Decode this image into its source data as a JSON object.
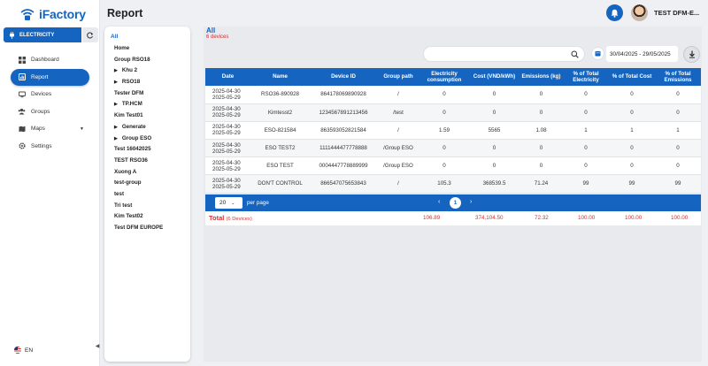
{
  "app": {
    "logo_text": "iFactory"
  },
  "sidebar": {
    "module_label": "ELECTRICITY",
    "items": [
      {
        "label": "Dashboard",
        "icon": "dashboard-icon"
      },
      {
        "label": "Report",
        "icon": "report-icon",
        "active": true
      },
      {
        "label": "Devices",
        "icon": "devices-icon"
      },
      {
        "label": "Groups",
        "icon": "groups-icon"
      },
      {
        "label": "Maps",
        "icon": "maps-icon"
      },
      {
        "label": "Settings",
        "icon": "settings-icon"
      }
    ],
    "language": "EN"
  },
  "header": {
    "title": "Report",
    "user_name": "TEST DFM-E..."
  },
  "tree": {
    "all_label": "All",
    "nodes": [
      {
        "label": "Home",
        "expandable": false
      },
      {
        "label": "Group RSO18",
        "expandable": false
      },
      {
        "label": "Khu 2",
        "expandable": true
      },
      {
        "label": "RSO18",
        "expandable": true
      },
      {
        "label": "Tester DFM",
        "expandable": false
      },
      {
        "label": "TP.HCM",
        "expandable": true
      },
      {
        "label": "Kim Test01",
        "expandable": false
      },
      {
        "label": "Generate",
        "expandable": true
      },
      {
        "label": "Group ESO",
        "expandable": true
      },
      {
        "label": "Test 16042025",
        "expandable": false
      },
      {
        "label": "TEST RSO36",
        "expandable": false
      },
      {
        "label": "Xuong A",
        "expandable": false
      },
      {
        "label": "test-group",
        "expandable": false
      },
      {
        "label": "test",
        "expandable": false
      },
      {
        "label": "Tri test",
        "expandable": false
      },
      {
        "label": "Kim Test02",
        "expandable": false
      },
      {
        "label": "Test DFM EUROPE",
        "expandable": false
      }
    ]
  },
  "main": {
    "title": "All",
    "device_count": "6 devices",
    "search_placeholder": "",
    "date_range": "30/04/2025 - 29/05/2025",
    "table": {
      "headers": [
        "Date",
        "Name",
        "Device ID",
        "Group path",
        "Electricity consumption",
        "Cost (VND/kWh)",
        "Emissions (kg)",
        "% of Total Electricity",
        "% of Total Cost",
        "% of Total Emissions"
      ],
      "rows": [
        [
          "2025-04-30\n2025-05-29",
          "RSO36-890928",
          "864178069890928",
          "/",
          "0",
          "0",
          "0",
          "0",
          "0",
          "0"
        ],
        [
          "2025-04-30\n2025-05-29",
          "Kimtesst2",
          "1234567891213456",
          "/test",
          "0",
          "0",
          "0",
          "0",
          "0",
          "0"
        ],
        [
          "2025-04-30\n2025-05-29",
          "ESO-821584",
          "863593052821584",
          "/",
          "1.59",
          "5565",
          "1.08",
          "1",
          "1",
          "1"
        ],
        [
          "2025-04-30\n2025-05-29",
          "ESO TEST2",
          "1111444477778888",
          "/Group ESO",
          "0",
          "0",
          "0",
          "0",
          "0",
          "0"
        ],
        [
          "2025-04-30\n2025-05-29",
          "ESO TEST",
          "0004447778889999",
          "/Group ESO",
          "0",
          "0",
          "0",
          "0",
          "0",
          "0"
        ],
        [
          "2025-04-30\n2025-05-29",
          "DON'T CONTROL",
          "866547075653843",
          "/",
          "105.3",
          "368539.5",
          "71.24",
          "99",
          "99",
          "99"
        ]
      ]
    },
    "pagination": {
      "per_page_value": "20",
      "per_page_label": "per page",
      "current_page": "1"
    },
    "total": {
      "label": "Total",
      "devices": "(6 Devices)",
      "electricity": "106.89",
      "cost": "374,104.50",
      "emissions": "72.32",
      "pct_electricity": "100.00",
      "pct_cost": "100.00",
      "pct_emissions": "100.00"
    }
  },
  "colors": {
    "primary": "#1565c0",
    "danger": "#d32f2f"
  }
}
